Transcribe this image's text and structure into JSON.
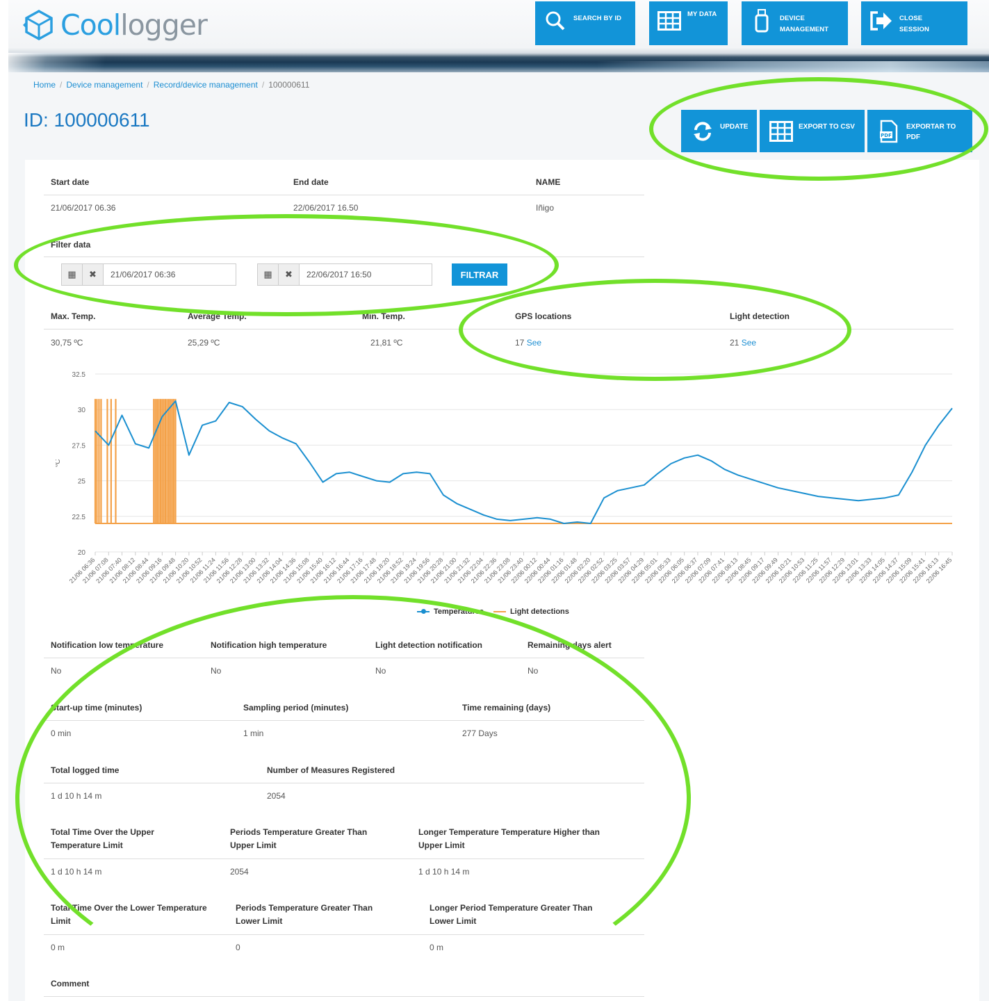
{
  "logo": {
    "part1": "Cool",
    "part2": "logger"
  },
  "top_nav": [
    {
      "label_lines": [
        "SEARCH BY ID"
      ],
      "icon": "search-icon"
    },
    {
      "label_lines": [
        "MY DATA"
      ],
      "icon": "grid-icon"
    },
    {
      "label_lines": [
        "DEVICE",
        "MANAGEMENT"
      ],
      "icon": "usb-device-icon"
    },
    {
      "label_lines": [
        "CLOSE",
        "SESSION"
      ],
      "icon": "logout-icon"
    }
  ],
  "breadcrumb": [
    "Home",
    "Device management",
    "Record/device management",
    "100000611"
  ],
  "page_title": "ID: 100000611",
  "actions": [
    {
      "label_lines": [
        "UPDATE"
      ],
      "icon": "refresh-icon"
    },
    {
      "label_lines": [
        "EXPORT TO CSV"
      ],
      "icon": "csv-grid-icon"
    },
    {
      "label_lines": [
        "EXPORTAR TO",
        "PDF"
      ],
      "icon": "pdf-file-icon"
    }
  ],
  "record": {
    "start_label": "Start date",
    "end_label": "End date",
    "name_label": "NAME",
    "start": "21/06/2017 06.36",
    "end": "22/06/2017 16.50",
    "name": "Iñigo"
  },
  "filter": {
    "label": "Filter data",
    "from": "21/06/2017 06:36",
    "to": "22/06/2017 16:50",
    "button": "FILTRAR"
  },
  "stats": {
    "max_label": "Max. Temp.",
    "avg_label": "Average Temp.",
    "min_label": "Min. Temp.",
    "gps_label": "GPS locations",
    "light_label": "Light detection",
    "max": "30,75 ºC",
    "avg": "25,29 ºC",
    "min": "21,81 ºC",
    "gps_count": "17",
    "light_count": "21",
    "see": "See"
  },
  "chart_data": {
    "type": "line",
    "ylabel": "ºC",
    "ylim": [
      20,
      32.5
    ],
    "yticks": [
      "32.5",
      "30",
      "27.5",
      "25",
      "22.5",
      "20"
    ],
    "x": [
      "21/06 06:36",
      "21/06 07:08",
      "21/06 07:40",
      "21/06 08:12",
      "21/06 08:44",
      "21/06 09:16",
      "21/06 09:48",
      "21/06 10:20",
      "21/06 10:52",
      "21/06 11:24",
      "21/06 11:56",
      "21/06 12:28",
      "21/06 13:00",
      "21/06 13:32",
      "21/06 14:04",
      "21/06 14:36",
      "21/06 15:08",
      "21/06 15:40",
      "21/06 16:12",
      "21/06 16:44",
      "21/06 17:16",
      "21/06 17:48",
      "21/06 18:20",
      "21/06 18:52",
      "21/06 19:24",
      "21/06 19:56",
      "21/06 20:28",
      "21/06 21:00",
      "21/06 21:32",
      "21/06 22:04",
      "21/06 22:36",
      "21/06 23:08",
      "21/06 23:40",
      "22/06 00:12",
      "22/06 00:44",
      "22/06 01:16",
      "22/06 01:48",
      "22/06 02:20",
      "22/06 02:52",
      "22/06 03:25",
      "22/06 03:57",
      "22/06 04:29",
      "22/06 05:01",
      "22/06 05:33",
      "22/06 06:05",
      "22/06 06:37",
      "22/06 07:09",
      "22/06 07:41",
      "22/06 08:13",
      "22/06 08:45",
      "22/06 09:17",
      "22/06 09:49",
      "22/06 10:21",
      "22/06 10:53",
      "22/06 11:25",
      "22/06 11:57",
      "22/06 12:29",
      "22/06 13:01",
      "22/06 13:33",
      "22/06 14:05",
      "22/06 14:37",
      "22/06 15:09",
      "22/06 15:41",
      "22/06 16:13",
      "22/06 16:45"
    ],
    "series": [
      {
        "name": "Temperatures",
        "color": "#1a8fd0",
        "values": [
          28.5,
          27.5,
          29.6,
          27.6,
          27.3,
          29.5,
          30.6,
          26.8,
          28.9,
          29.2,
          30.5,
          30.2,
          29.3,
          28.5,
          28.0,
          27.6,
          26.3,
          24.9,
          25.5,
          25.6,
          25.3,
          25.0,
          24.9,
          25.5,
          25.6,
          25.5,
          24.0,
          23.4,
          23.0,
          22.6,
          22.3,
          22.2,
          22.3,
          22.4,
          22.3,
          22.0,
          22.1,
          22.0,
          23.8,
          24.3,
          24.5,
          24.7,
          25.5,
          26.2,
          26.6,
          26.8,
          26.4,
          25.8,
          25.4,
          25.1,
          24.8,
          24.5,
          24.3,
          24.1,
          23.9,
          23.8,
          23.7,
          23.6,
          23.7,
          23.8,
          24.0,
          25.6,
          27.5,
          28.9,
          30.1
        ]
      },
      {
        "name": "Light detections",
        "color": "#f4a148",
        "baseline": 22.0,
        "spikes": [
          "21/06 06:36",
          "21/06 06:40",
          "21/06 06:45",
          "21/06 06:50",
          "21/06 07:05",
          "21/06 07:14",
          "21/06 07:25",
          "21/06 08:56",
          "21/06 09:00",
          "21/06 09:04",
          "21/06 09:08",
          "21/06 09:12",
          "21/06 09:16",
          "21/06 09:20",
          "21/06 09:24",
          "21/06 09:28",
          "21/06 09:32",
          "21/06 09:36",
          "21/06 09:40",
          "21/06 09:44",
          "21/06 09:48"
        ],
        "spike_value": 30.75
      }
    ],
    "legend": "bottom-center",
    "grid": true
  },
  "notifications": {
    "low_label": "Notification low temperature",
    "high_label": "Notification high temperature",
    "light_label": "Light detection notification",
    "days_label": "Remaining days alert",
    "low": "No",
    "high": "No",
    "light": "No",
    "days": "No"
  },
  "timing": {
    "startup_label": "Start-up time (minutes)",
    "sampling_label": "Sampling period (minutes)",
    "remaining_label": "Time remaining (days)",
    "startup": "0 min",
    "sampling": "1 min",
    "remaining": "277 Days"
  },
  "totals": {
    "logged_label": "Total logged time",
    "measures_label": "Number of Measures Registered",
    "logged": "1 d 10 h 14 m",
    "measures": "2054"
  },
  "upper": {
    "time_label_1": "Total Time Over the Upper",
    "time_label_2": "Temperature Limit",
    "periods_label_1": "Periods Temperature Greater Than",
    "periods_label_2": "Upper Limit",
    "longer_label_1": "Longer Temperature Temperature Higher than",
    "longer_label_2": "Upper Limit",
    "time": "1 d 10 h 14 m",
    "periods": "2054",
    "longer": "1 d 10 h 14 m"
  },
  "lower": {
    "time_label_1": "Total Time Over the Lower Temperature",
    "time_label_2": "Limit",
    "periods_label_1": "Periods Temperature Greater Than",
    "periods_label_2": "Lower Limit",
    "longer_label_1": "Longer Period Temperature Greater Than",
    "longer_label_2": "Lower Limit",
    "time": "0 m",
    "periods": "0",
    "longer": "0 m"
  },
  "comment_label": "Comment",
  "colors": {
    "accent": "#1294d8",
    "annotation": "#72e02a"
  }
}
